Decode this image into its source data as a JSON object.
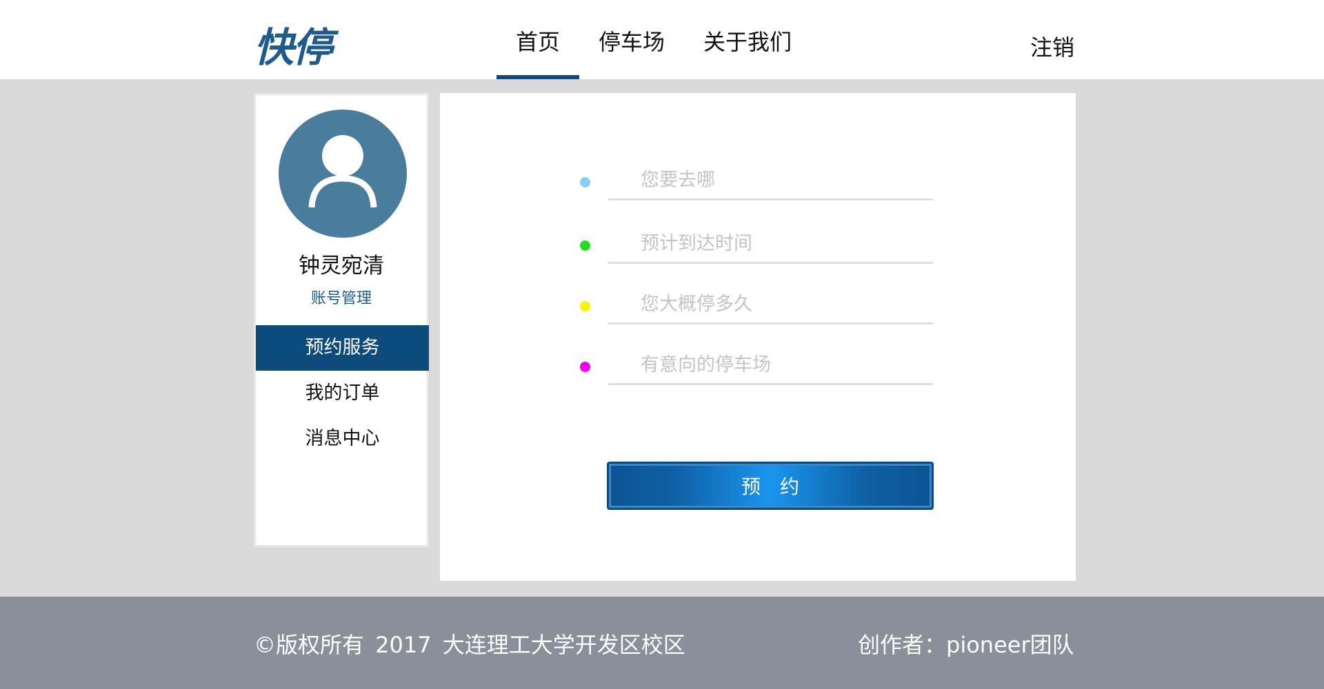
{
  "header": {
    "logo": "快停",
    "nav": [
      {
        "label": "首页",
        "active": true
      },
      {
        "label": "停车场",
        "active": false
      },
      {
        "label": "关于我们",
        "active": false
      }
    ],
    "logout": "注销"
  },
  "sidebar": {
    "avatar_icon": "user-icon",
    "username": "钟灵宛清",
    "account_link": "账号管理",
    "menu": [
      {
        "label": "预约服务",
        "active": true
      },
      {
        "label": "我的订单",
        "active": false
      },
      {
        "label": "消息中心",
        "active": false
      }
    ]
  },
  "form": {
    "fields": [
      {
        "placeholder": "您要去哪",
        "value": "",
        "dot_color": "#87cef5"
      },
      {
        "placeholder": "预计到达时间",
        "value": "",
        "dot_color": "#22dd22"
      },
      {
        "placeholder": "您大概停多久",
        "value": "",
        "dot_color": "#f5f500"
      },
      {
        "placeholder": "有意向的停车场",
        "value": "",
        "dot_color": "#ee00ee"
      }
    ],
    "submit_label": "预约"
  },
  "footer": {
    "copyright": "©版权所有 2017 大连理工大学开发区校区",
    "author": "创作者：pioneer团队"
  },
  "colors": {
    "brand": "#0d4b7d",
    "avatar_bg": "#4a7c9e",
    "footer_bg": "#8a9099",
    "page_bg": "#dadada"
  }
}
